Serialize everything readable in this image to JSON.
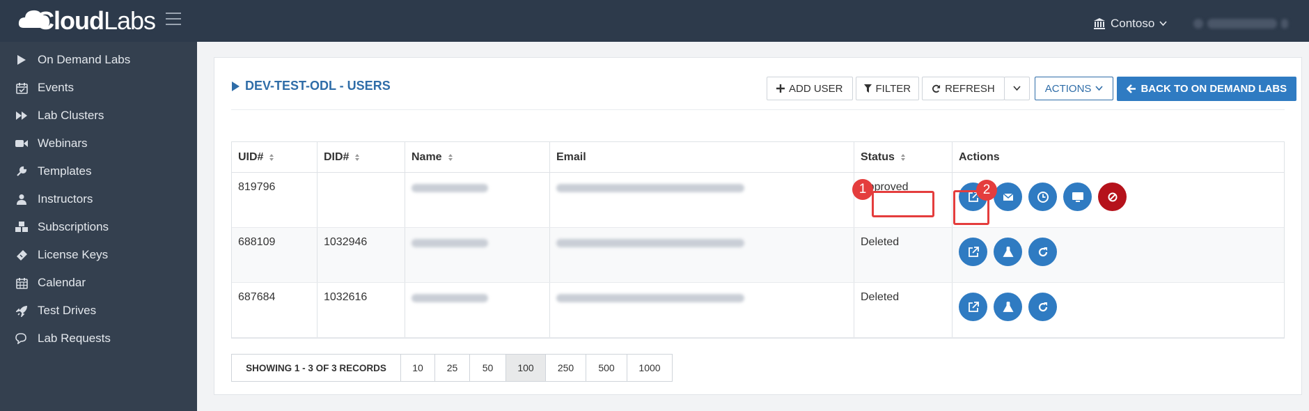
{
  "brand": {
    "logo_text_bold": "Cloud",
    "logo_text_thin": "Labs"
  },
  "topbar": {
    "tenant": "Contoso"
  },
  "sidebar": {
    "items": [
      {
        "label": "On Demand Labs",
        "icon": "play-icon"
      },
      {
        "label": "Events",
        "icon": "calendar-check-icon"
      },
      {
        "label": "Lab Clusters",
        "icon": "fast-forward-icon"
      },
      {
        "label": "Webinars",
        "icon": "video-camera-icon"
      },
      {
        "label": "Templates",
        "icon": "wrench-icon"
      },
      {
        "label": "Instructors",
        "icon": "user-icon"
      },
      {
        "label": "Subscriptions",
        "icon": "cubes-icon"
      },
      {
        "label": "License Keys",
        "icon": "ticket-icon"
      },
      {
        "label": "Calendar",
        "icon": "calendar-icon"
      },
      {
        "label": "Test Drives",
        "icon": "rocket-icon"
      },
      {
        "label": "Lab Requests",
        "icon": "comments-icon"
      }
    ]
  },
  "page": {
    "title": "DEV-TEST-ODL - USERS"
  },
  "toolbar": {
    "add_user": "ADD USER",
    "filter": "FILTER",
    "refresh": "REFRESH",
    "actions": "ACTIONS",
    "back": "BACK TO ON DEMAND LABS"
  },
  "table": {
    "headers": {
      "uid": "UID#",
      "did": "DID#",
      "name": "Name",
      "email": "Email",
      "status": "Status",
      "actions": "Actions"
    },
    "rows": [
      {
        "uid": "819796",
        "did": "",
        "status": "Approved",
        "actions": [
          "open-link-icon",
          "envelope-icon",
          "clock-icon",
          "monitor-icon",
          "ban-icon"
        ]
      },
      {
        "uid": "688109",
        "did": "1032946",
        "status": "Deleted",
        "actions": [
          "open-link-icon",
          "flask-icon",
          "redo-icon"
        ]
      },
      {
        "uid": "687684",
        "did": "1032616",
        "status": "Deleted",
        "actions": [
          "open-link-icon",
          "flask-icon",
          "redo-icon"
        ]
      }
    ]
  },
  "callouts": {
    "one": "1",
    "two": "2"
  },
  "pagination": {
    "info": "SHOWING 1 - 3 OF 3 RECORDS",
    "sizes": [
      "10",
      "25",
      "50",
      "100",
      "250",
      "500",
      "1000"
    ],
    "active": "100"
  },
  "colors": {
    "primary": "#2f7bc2",
    "danger": "#b5121b",
    "callout": "#e43d3d",
    "sidebar": "#34404f",
    "topbar": "#2d3a4b"
  }
}
